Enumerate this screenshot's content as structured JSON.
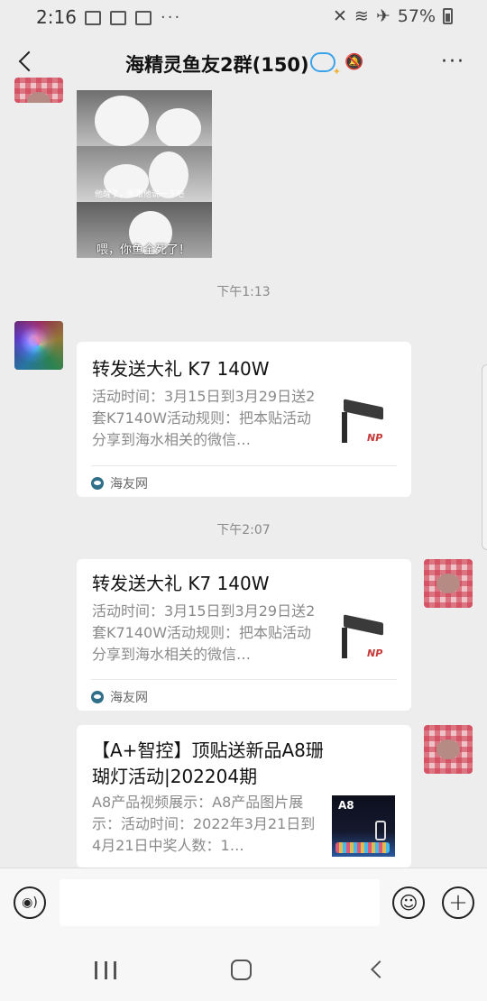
{
  "status_bar": {
    "time": "2:16",
    "battery": "57%",
    "dots": "···"
  },
  "header": {
    "title": "海精灵鱼友2群(150)",
    "more": "···"
  },
  "meme": {
    "caption_small": "他醒了，你跟他说一下吧",
    "caption_large": "喂，你鱼全死了！"
  },
  "messages": [
    {
      "type": "time",
      "text": "下午1:13"
    },
    {
      "type": "link_card",
      "side": "left",
      "title": "转发送大礼  K7 140W",
      "desc": "活动时间：3月15日到3月29日送2套K7140W活动规则：把本贴活动分享到海水相关的微信…",
      "source": "海友网",
      "thumb_logo": "NP"
    },
    {
      "type": "time",
      "text": "下午2:07"
    },
    {
      "type": "link_card",
      "side": "right",
      "title": "转发送大礼  K7 140W",
      "desc": "活动时间：3月15日到3月29日送2套K7140W活动规则：把本贴活动分享到海水相关的微信…",
      "source": "海友网",
      "thumb_logo": "NP"
    },
    {
      "type": "link_card",
      "side": "right",
      "title": "【A+智控】顶贴送新品A8珊 瑚灯活动|202204期",
      "desc": "A8产品视频展示：A8产品图片展示：活动时间：2022年3月21日到4月21日中奖人数：1…",
      "thumb_logo": "A8"
    }
  ],
  "input_bar": {
    "placeholder": ""
  },
  "icons": {
    "voice": "voice-icon",
    "emoji": "emoji-icon",
    "plus": "plus-icon",
    "source": "source-icon"
  },
  "colors": {
    "background": "#ededed",
    "card": "#ffffff",
    "bubble_icon": "#3ba3ea"
  }
}
